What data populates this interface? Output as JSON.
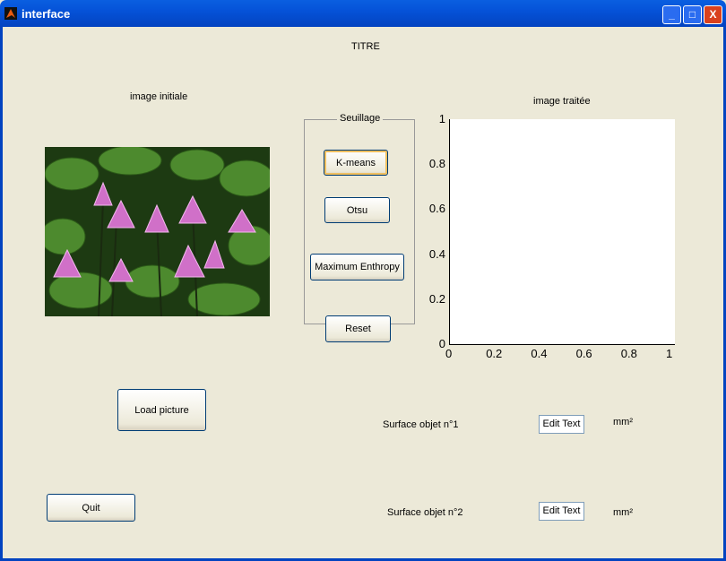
{
  "window": {
    "title": "interface",
    "buttons": [
      "minimize",
      "maximize",
      "close"
    ]
  },
  "main": {
    "title": "TITRE",
    "image_initial_label": "image initiale",
    "image_processed_label": "image traitée",
    "group": {
      "title": "Seuillage",
      "buttons": [
        "K-means",
        "Otsu",
        "Maximum Enthropy",
        "Reset"
      ]
    },
    "load_button": "Load picture",
    "quit_button": "Quit",
    "surface1": {
      "label": "Surface objet n°1",
      "value": "Edit Text",
      "unit": "mm²"
    },
    "surface2": {
      "label": "Surface objet n°2",
      "value": "Edit Text",
      "unit": "mm²"
    }
  },
  "chart_data": {
    "type": "line",
    "xlim": [
      0,
      1
    ],
    "ylim": [
      0,
      1
    ],
    "xticks": [
      "0",
      "0.2",
      "0.4",
      "0.6",
      "0.8",
      "1"
    ],
    "yticks": [
      "0",
      "0.2",
      "0.4",
      "0.6",
      "0.8",
      "1"
    ],
    "series": []
  }
}
